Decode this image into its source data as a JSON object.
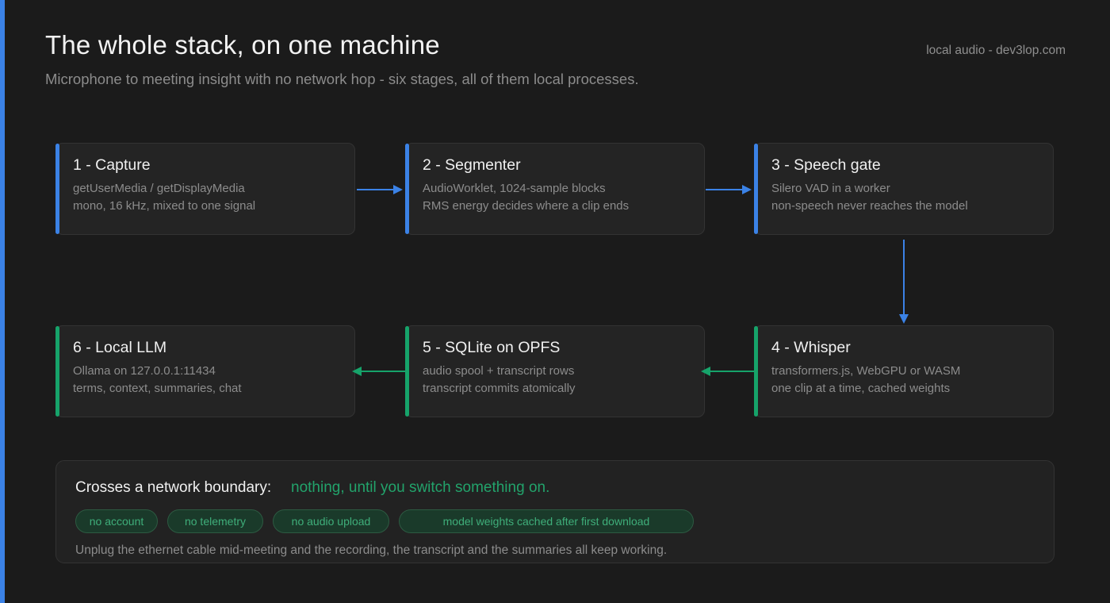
{
  "header": {
    "title": "The whole stack, on one machine",
    "subtitle": "Microphone to meeting insight with no network hop - six stages, all of them local processes.",
    "site": "local audio - dev3lop.com"
  },
  "stages": [
    {
      "name": "1 - Capture",
      "lines": [
        "getUserMedia / getDisplayMedia",
        "mono, 16 kHz, mixed to one signal"
      ],
      "color": "#3b82e6"
    },
    {
      "name": "2 - Segmenter",
      "lines": [
        "AudioWorklet, 1024-sample blocks",
        "RMS energy decides where a clip ends"
      ],
      "color": "#3b82e6"
    },
    {
      "name": "3 - Speech gate",
      "lines": [
        "Silero VAD in a worker",
        "non-speech never reaches the model"
      ],
      "color": "#3b82e6"
    },
    {
      "name": "4 - Whisper",
      "lines": [
        "transformers.js, WebGPU or WASM",
        "one clip at a time, cached weights"
      ],
      "color": "#16a36a"
    },
    {
      "name": "5 - SQLite on OPFS",
      "lines": [
        "audio spool + transcript rows",
        "transcript commits atomically"
      ],
      "color": "#16a36a"
    },
    {
      "name": "6 - Local LLM",
      "lines": [
        "Ollama on 127.0.0.1:11434",
        "terms, context, summaries, chat"
      ],
      "color": "#16a36a"
    }
  ],
  "network": {
    "heading": "Crosses a network boundary:",
    "answer": "nothing, until you switch something on.",
    "chips": [
      "no account",
      "no telemetry",
      "no audio upload",
      "model weights cached after first download"
    ],
    "note": "Unplug the ethernet cable mid-meeting and the recording, the transcript and the summaries all keep working."
  },
  "colors": {
    "background": "#1b1b1b",
    "blue": "#3b82e6",
    "green": "#16a36a",
    "chip_text": "#3fae7a"
  }
}
